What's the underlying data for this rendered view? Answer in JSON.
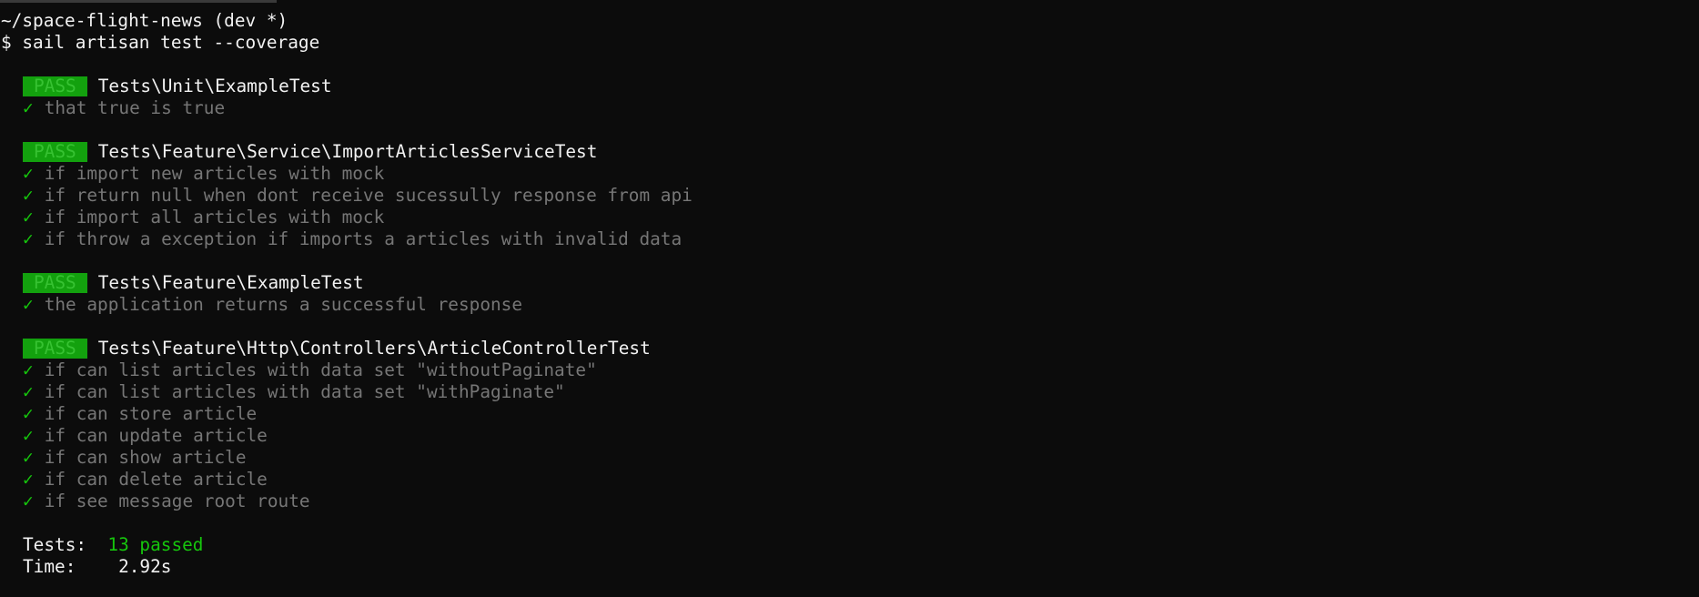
{
  "prompt": {
    "path": "~/space-flight-news (dev *)",
    "symbol": "$",
    "command": "sail artisan test --coverage"
  },
  "suites": [
    {
      "badge": "PASS",
      "name": "Tests\\Unit\\ExampleTest",
      "tests": [
        {
          "check": "✓",
          "text": "that true is true"
        }
      ]
    },
    {
      "badge": "PASS",
      "name": "Tests\\Feature\\Service\\ImportArticlesServiceTest",
      "tests": [
        {
          "check": "✓",
          "text": "if import new articles with mock"
        },
        {
          "check": "✓",
          "text": "if return null when dont receive sucessully response from api"
        },
        {
          "check": "✓",
          "text": "if import all articles with mock"
        },
        {
          "check": "✓",
          "text": "if throw a exception if imports a articles with invalid data"
        }
      ]
    },
    {
      "badge": "PASS",
      "name": "Tests\\Feature\\ExampleTest",
      "tests": [
        {
          "check": "✓",
          "text": "the application returns a successful response"
        }
      ]
    },
    {
      "badge": "PASS",
      "name": "Tests\\Feature\\Http\\Controllers\\ArticleControllerTest",
      "tests": [
        {
          "check": "✓",
          "text": "if can list articles with data set \"withoutPaginate\""
        },
        {
          "check": "✓",
          "text": "if can list articles with data set \"withPaginate\""
        },
        {
          "check": "✓",
          "text": "if can store article"
        },
        {
          "check": "✓",
          "text": "if can update article"
        },
        {
          "check": "✓",
          "text": "if can show article"
        },
        {
          "check": "✓",
          "text": "if can delete article"
        },
        {
          "check": "✓",
          "text": "if see message root route"
        }
      ]
    }
  ],
  "summary": {
    "tests_label": "Tests:",
    "tests_value": "13 passed",
    "time_label": "Time:",
    "time_value": "2.92s"
  },
  "colors": {
    "background": "#0c0c0c",
    "foreground": "#f2f2f2",
    "dim_text": "#767676",
    "pass_badge_bg": "#13a10e",
    "success_green": "#16c60c"
  }
}
